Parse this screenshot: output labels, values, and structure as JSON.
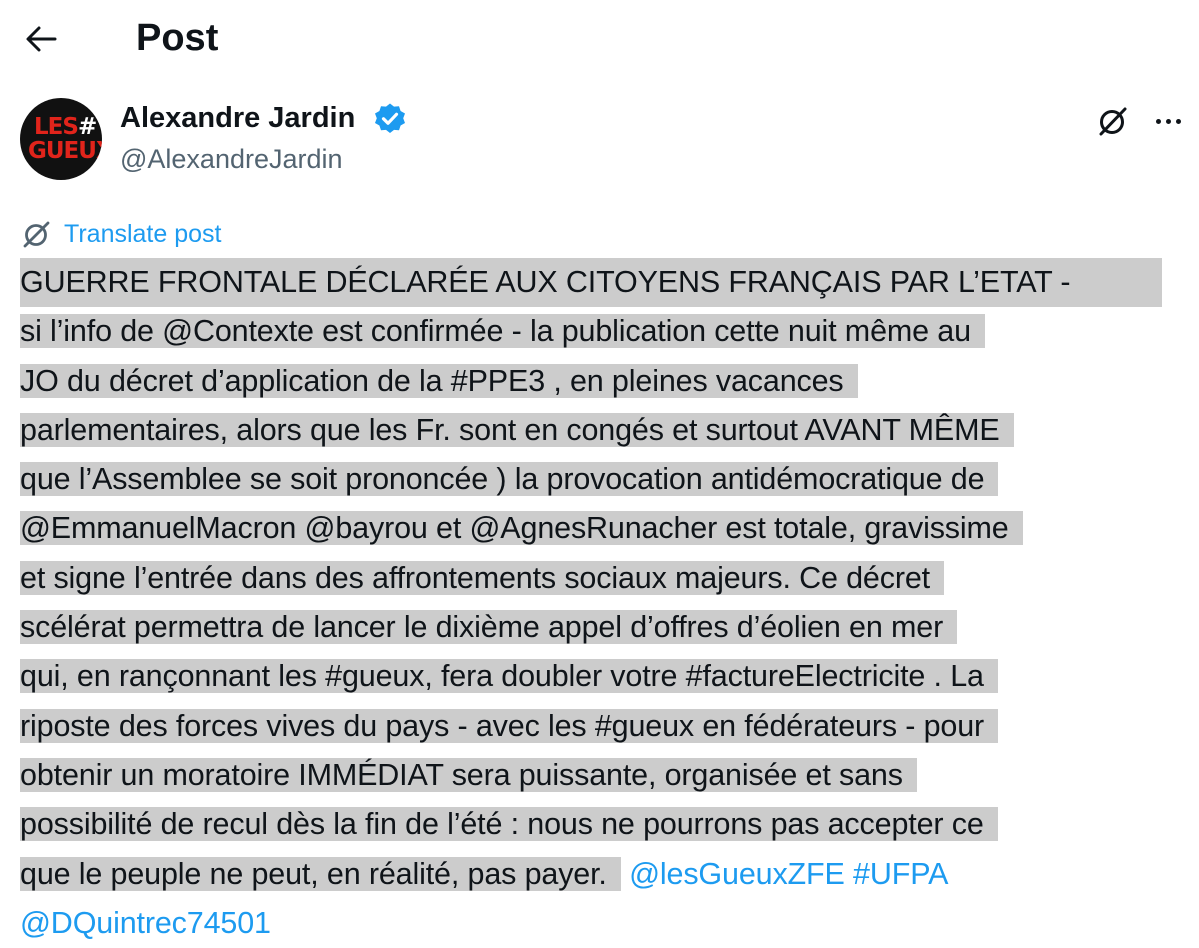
{
  "header": {
    "title": "Post"
  },
  "author": {
    "name": "Alexandre Jardin",
    "handle": "@AlexandreJardin",
    "avatar_text_1": "LES",
    "avatar_hash": "#",
    "avatar_text_2": "GUEUX"
  },
  "actions": {
    "translate_label": "Translate post"
  },
  "post": {
    "l1": "GUERRE FRONTALE DÉCLARÉE AUX CITOYENS FRANÇAIS PAR L’ETAT -",
    "l2a": "si l’info de ",
    "l2_mention": "@Contexte",
    "l2b": " est confirmée - la publication cette nuit même au",
    "l3a": "JO du décret d’application de la ",
    "l3_tag": "#PPE3",
    "l3b": " , en pleines vacances",
    "l4": "parlementaires, alors que les Fr. sont en congés et surtout AVANT MÊME",
    "l5": "que l’Assemblee se soit prononcée ) la provocation antidémocratique de",
    "l6_m1": "@EmmanuelMacron",
    "l6_s1": " ",
    "l6_m2": "@bayrou",
    "l6_s2": " et ",
    "l6_m3": "@AgnesRunacher",
    "l6_s3": " est totale, gravissime",
    "l7": "et signe l’entrée dans des affrontements sociaux majeurs. Ce décret",
    "l8": "scélérat permettra de lancer le dixième appel d’offres d’éolien en mer",
    "l9a": "qui, en rançonnant les ",
    "l9_tag1": "#gueux",
    "l9b": ", fera doubler votre ",
    "l9_tag2": "#factureElectricite",
    "l9c": " . La",
    "l10a": "riposte des forces vives du pays - avec les ",
    "l10_tag": "#gueux",
    "l10b": " en fédérateurs - pour",
    "l11": "obtenir un moratoire IMMÉDIAT sera puissante, organisée et sans",
    "l12": "possibilité de recul dès la fin de l’été : nous ne pourrons pas accepter ce",
    "l13": "que le peuple ne peut, en réalité, pas payer.",
    "l13_m1": "@lesGueuxZFE",
    "l13_tag": "#UFPA",
    "l14_m1": "@DQuintrec74501"
  },
  "colors": {
    "link": "#1d9bf0",
    "selection": "#cccccc",
    "secondary_text": "#536471",
    "verified": "#1d9bf0"
  }
}
